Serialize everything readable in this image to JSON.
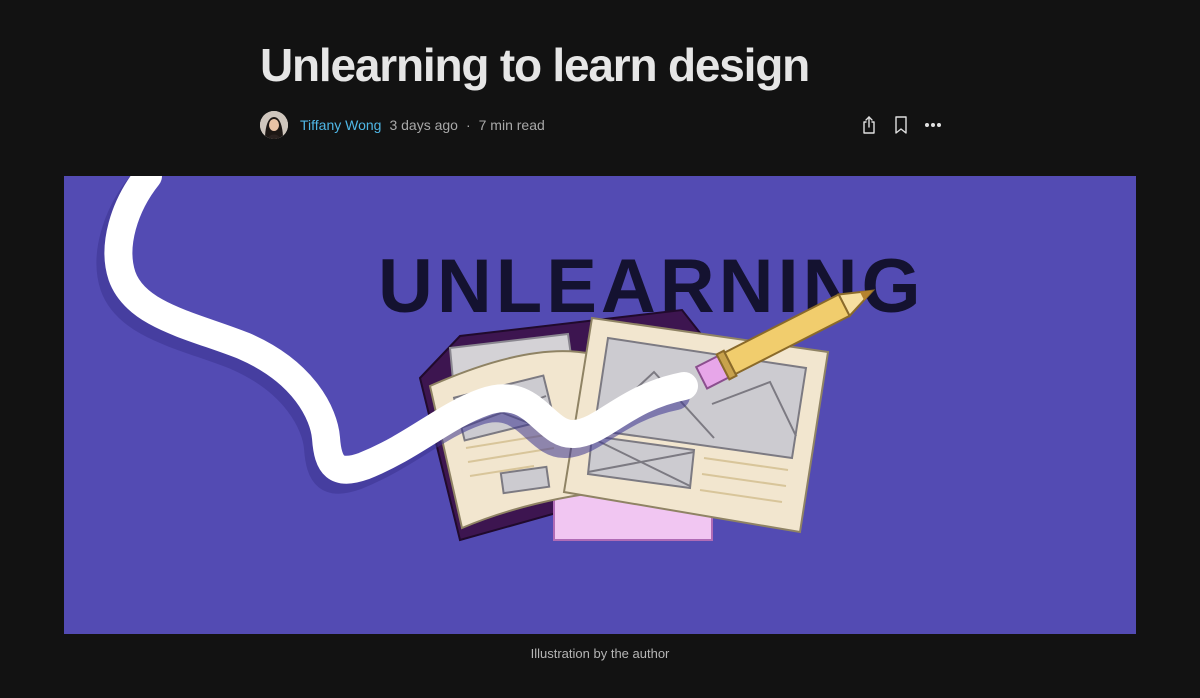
{
  "article": {
    "title": "Unlearning to learn design",
    "author": "Tiffany Wong",
    "published": "3 days ago",
    "separator": "·",
    "read_time": "7 min read"
  },
  "actions": [
    {
      "icon": "share-icon"
    },
    {
      "icon": "bookmark-icon"
    },
    {
      "icon": "more-icon"
    }
  ],
  "hero": {
    "illustration_text": "UNLEARNING",
    "caption": "Illustration by the author"
  },
  "colors": {
    "background": "#121212",
    "title": "#e6e6e6",
    "author_link": "#4fb7e6",
    "meta_text": "#a8a8a8",
    "hero_bg": "#534bb3",
    "illustration_ink": "#141230",
    "paper": "#f2e6cf",
    "pencil": "#f1cd6d",
    "eraser": "#e7a6e9"
  }
}
